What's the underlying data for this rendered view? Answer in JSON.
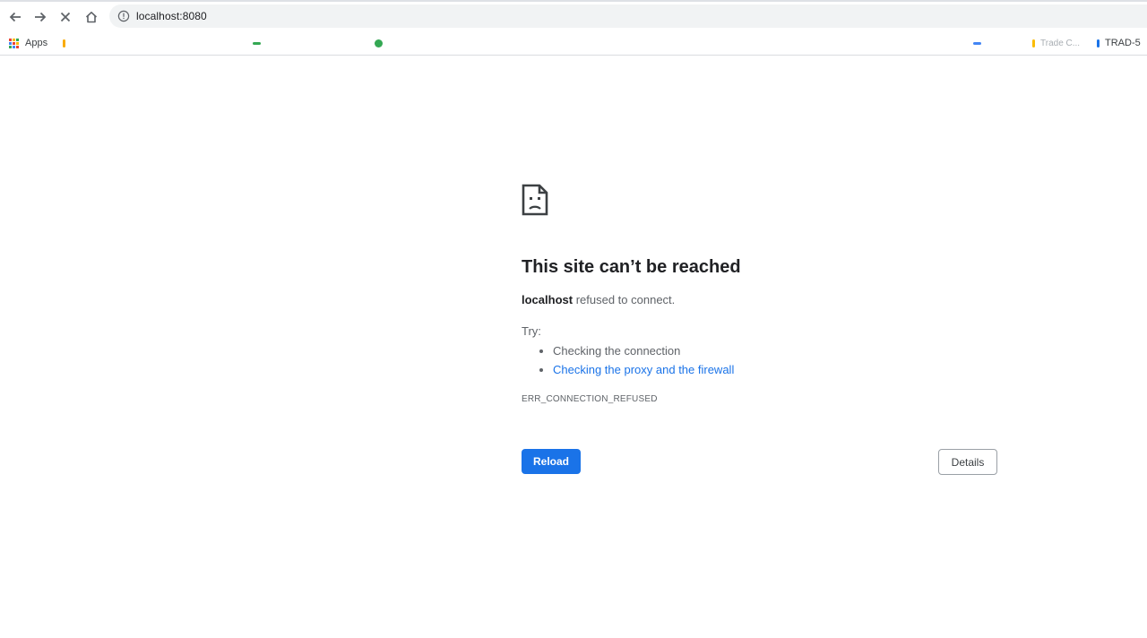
{
  "browser": {
    "url": "localhost:8080",
    "status": "loading",
    "icons": {
      "back": "arrow-left-icon",
      "forward": "arrow-right-icon",
      "stop": "close-icon",
      "home": "home-icon",
      "site_info": "info-circle-icon"
    }
  },
  "bookmarks": {
    "apps_label": "Apps",
    "items": [
      {
        "label": "",
        "color": "#f9ab00"
      },
      {
        "label": "",
        "color": "#34a853"
      },
      {
        "label": "",
        "color": "#1a73e8"
      },
      {
        "label": "",
        "color": "#ea4335"
      },
      {
        "label": "Trade C...",
        "color": "#fbbc04"
      },
      {
        "label": "TRAD-5",
        "color": "#1a73e8"
      }
    ]
  },
  "error_page": {
    "title": "This site can’t be reached",
    "host": "localhost",
    "message": "refused to connect.",
    "try_label": "Try:",
    "suggestions": [
      "Checking the connection",
      "Checking the proxy and the firewall"
    ],
    "error_code": "ERR_CONNECTION_REFUSED",
    "reload_label": "Reload",
    "details_label": "Details"
  },
  "colors": {
    "accent": "#1a73e8",
    "text": "#202124",
    "secondary_text": "#5f6368"
  }
}
